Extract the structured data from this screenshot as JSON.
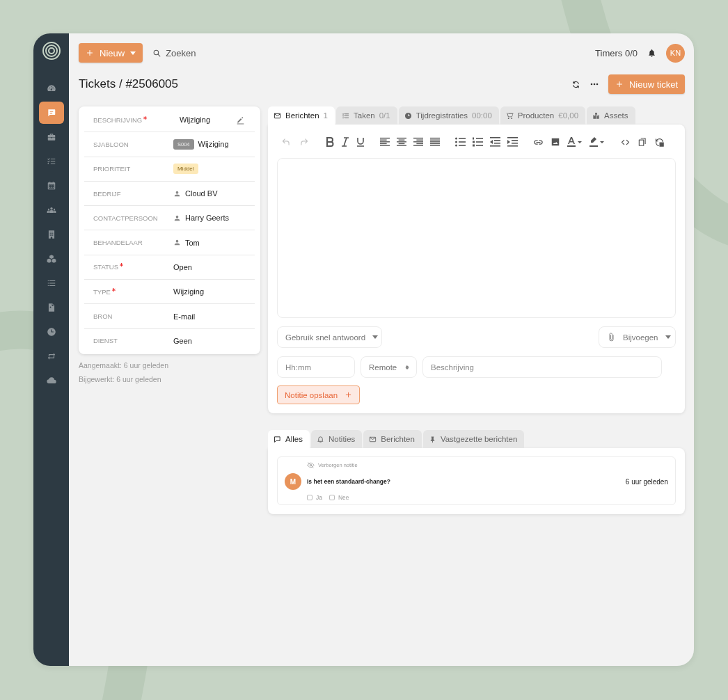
{
  "sidebar": {
    "items": [
      {
        "selected": false
      },
      {
        "selected": true
      },
      {
        "selected": false
      },
      {
        "selected": false
      },
      {
        "selected": false
      },
      {
        "selected": false
      },
      {
        "selected": false
      },
      {
        "selected": false
      },
      {
        "selected": false
      },
      {
        "selected": false
      },
      {
        "selected": false
      },
      {
        "selected": false
      },
      {
        "selected": false
      }
    ]
  },
  "topbar": {
    "new_button": "Nieuw",
    "search": {
      "placeholder": "Zoeken"
    },
    "timers": "Timers 0/0",
    "avatar": "KN"
  },
  "page": {
    "title": "Tickets / #2506005",
    "new_ticket_button": "Nieuw ticket"
  },
  "details": {
    "fields": [
      {
        "label": "BESCHRIJVING",
        "required": true,
        "kind": "editable",
        "value": "Wijziging"
      },
      {
        "label": "SJABLOON",
        "required": false,
        "kind": "tag",
        "tag": "S004",
        "value": "Wijziging"
      },
      {
        "label": "PRIORITEIT",
        "required": false,
        "kind": "badge",
        "value": "Middel"
      },
      {
        "label": "BEDRIJF",
        "required": false,
        "kind": "person",
        "value": "Cloud BV"
      },
      {
        "label": "CONTACTPERSOON",
        "required": false,
        "kind": "person",
        "value": "Harry Geerts"
      },
      {
        "label": "BEHANDELAAR",
        "required": false,
        "kind": "person",
        "value": "Tom"
      },
      {
        "label": "STATUS",
        "required": true,
        "kind": "text",
        "value": "Open"
      },
      {
        "label": "TYPE",
        "required": true,
        "kind": "text",
        "value": "Wijziging"
      },
      {
        "label": "BRON",
        "required": false,
        "kind": "text",
        "value": "E-mail"
      },
      {
        "label": "DIENST",
        "required": false,
        "kind": "text",
        "value": "Geen"
      }
    ],
    "meta": [
      "Aangemaakt: 6 uur geleden",
      "Bijgewerkt: 6 uur geleden"
    ]
  },
  "editor": {
    "tabs": [
      {
        "label": "Berichten",
        "count": "1",
        "selected": true
      },
      {
        "label": "Taken",
        "count": "0/1",
        "selected": false
      },
      {
        "label": "Tijdregistraties",
        "count": "00:00",
        "selected": false
      },
      {
        "label": "Producten",
        "count": "€0,00",
        "selected": false
      },
      {
        "label": "Assets",
        "selected": false
      }
    ],
    "quick_reply": "Gebruik snel antwoord",
    "attach": "Bijvoegen",
    "time_field": {
      "placeholder": "Hh:mm"
    },
    "location": "Remote",
    "description_field": {
      "placeholder": "Beschrijving"
    },
    "save_button": "Notitie opslaan"
  },
  "feed": {
    "tabs": [
      {
        "label": "Alles",
        "selected": true
      },
      {
        "label": "Notities",
        "selected": false
      },
      {
        "label": "Berichten",
        "selected": false
      },
      {
        "label": "Vastgezette berichten",
        "selected": false
      }
    ],
    "messages": [
      {
        "hidden_label": "Verborgen notitie",
        "avatar": "M",
        "text": "Is het een standaard-change?",
        "time": "6 uur geleden",
        "options": [
          {
            "label": "Ja",
            "checked": false
          },
          {
            "label": "Nee",
            "checked": false
          }
        ]
      }
    ]
  }
}
